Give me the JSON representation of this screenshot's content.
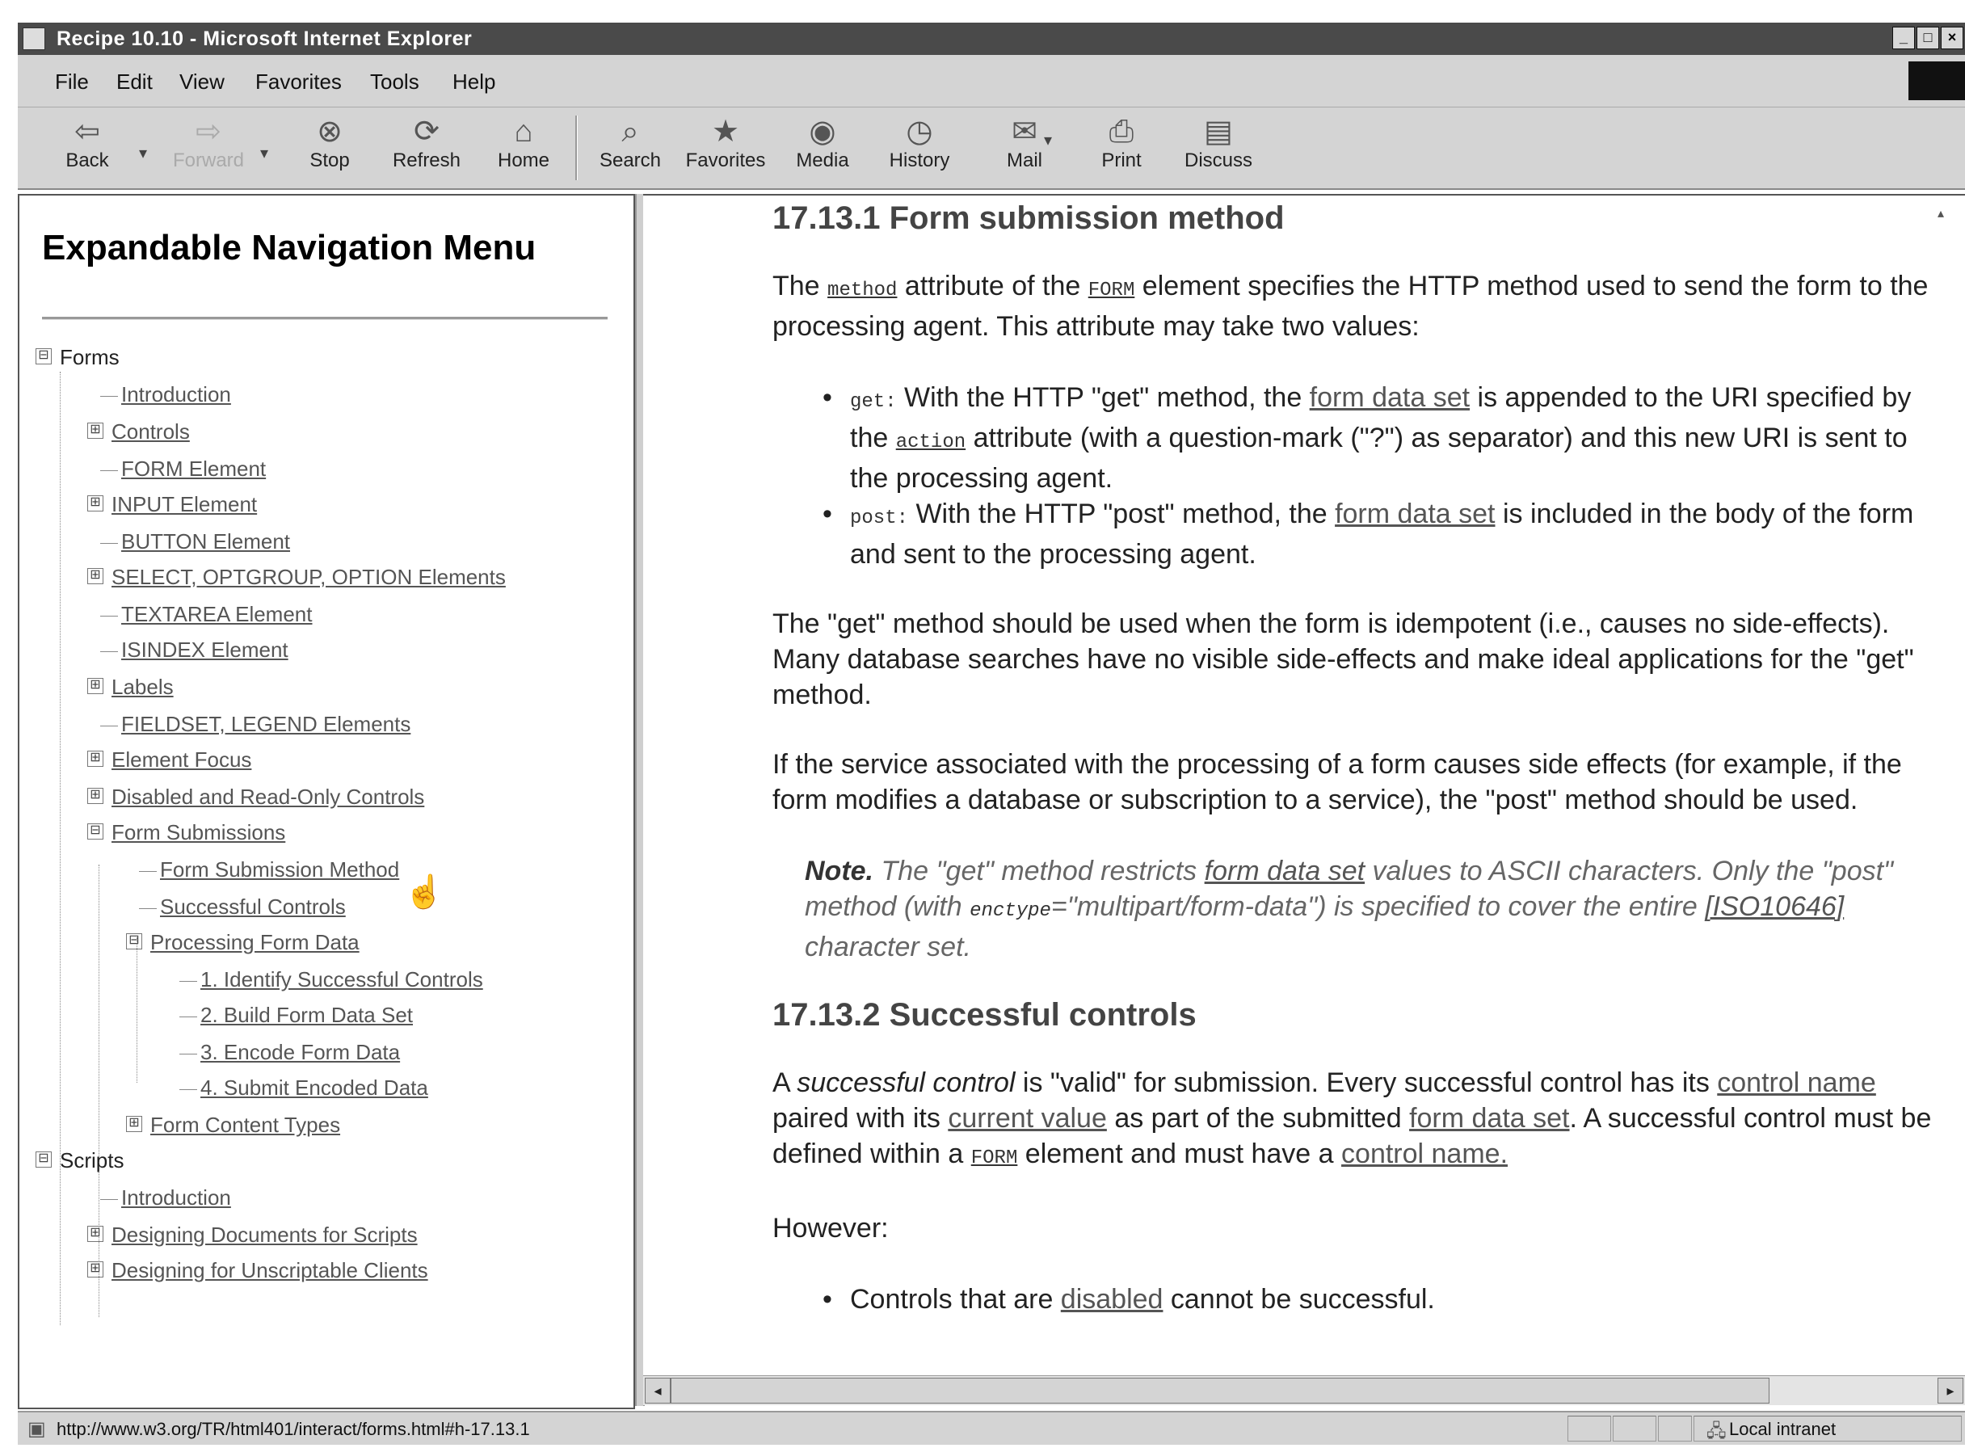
{
  "window": {
    "title": "Recipe 10.10 - Microsoft Internet Explorer",
    "controls": [
      "_",
      "□",
      "×"
    ]
  },
  "menu": [
    "File",
    "Edit",
    "View",
    "Favorites",
    "Tools",
    "Help"
  ],
  "toolbar": [
    {
      "label": "Back",
      "icon": "back-arrow-icon",
      "glyph": "⇦"
    },
    {
      "label": "Forward",
      "icon": "forward-arrow-icon",
      "glyph": "⇨"
    },
    {
      "label": "Stop",
      "icon": "stop-icon",
      "glyph": "⊗"
    },
    {
      "label": "Refresh",
      "icon": "refresh-icon",
      "glyph": "⟳"
    },
    {
      "label": "Home",
      "icon": "home-icon",
      "glyph": "⌂"
    },
    {
      "label": "Search",
      "icon": "search-icon",
      "glyph": "⌕"
    },
    {
      "label": "Favorites",
      "icon": "favorites-icon",
      "glyph": "★"
    },
    {
      "label": "Media",
      "icon": "media-icon",
      "glyph": "◉"
    },
    {
      "label": "History",
      "icon": "history-icon",
      "glyph": "◷"
    },
    {
      "label": "Mail",
      "icon": "mail-icon",
      "glyph": "✉"
    },
    {
      "label": "Print",
      "icon": "print-icon",
      "glyph": "⎙"
    },
    {
      "label": "Discuss",
      "icon": "discuss-icon",
      "glyph": "▤"
    }
  ],
  "nav": {
    "title": "Expandable Navigation Menu",
    "items": [
      {
        "label": "Forms",
        "expander": "⊟"
      },
      {
        "label": "Introduction"
      },
      {
        "label": "Controls",
        "expander": "⊞"
      },
      {
        "label": "FORM Element"
      },
      {
        "label": "INPUT Element",
        "expander": "⊞"
      },
      {
        "label": "BUTTON Element"
      },
      {
        "label": "SELECT, OPTGROUP, OPTION Elements",
        "expander": "⊞"
      },
      {
        "label": "TEXTAREA Element"
      },
      {
        "label": "ISINDEX Element"
      },
      {
        "label": "Labels",
        "expander": "⊞"
      },
      {
        "label": "FIELDSET, LEGEND Elements"
      },
      {
        "label": "Element Focus",
        "expander": "⊞"
      },
      {
        "label": "Disabled and Read-Only Controls",
        "expander": "⊞"
      },
      {
        "label": "Form Submissions",
        "expander": "⊟"
      },
      {
        "label": "Form Submission Method"
      },
      {
        "label": "Successful Controls"
      },
      {
        "label": "Processing Form Data",
        "expander": "⊟"
      },
      {
        "label": "1. Identify Successful Controls"
      },
      {
        "label": "2. Build Form Data Set"
      },
      {
        "label": "3. Encode Form Data"
      },
      {
        "label": "4. Submit Encoded Data"
      },
      {
        "label": "Form Content Types",
        "expander": "⊞"
      },
      {
        "label": "Scripts",
        "expander": "⊟"
      },
      {
        "label": "Introduction"
      },
      {
        "label": "Designing Documents for Scripts",
        "expander": "⊞"
      },
      {
        "label": "Designing for Unscriptable Clients",
        "expander": "⊞"
      }
    ]
  },
  "content": {
    "h1": "17.13.1 Form submission method",
    "p1": {
      "a": "The ",
      "method": "method",
      "b": " attribute of the ",
      "form": "FORM",
      "c": " element specifies the HTTP method used to send the form to the processing agent. This attribute may take two values:"
    },
    "get": {
      "code": "get:",
      "a": " With the HTTP \"get\" method, the ",
      "link": "form data set",
      "b": " is appended to the URI specified by the ",
      "action": "action",
      "c": " attribute (with a question-mark (\"?\") as separator) and this new URI is sent to the processing agent."
    },
    "post": {
      "code": "post:",
      "a": " With the HTTP \"post\" method, the ",
      "link": "form data set",
      "b": " is included in the body of the form and sent to the processing agent."
    },
    "p2": "The \"get\" method should be used when the form is idempotent (i.e., causes no side-effects). Many database searches have no visible side-effects and make ideal applications for the \"get\" method.",
    "p3": "If the service associated with the processing of a form causes side effects (for example, if the form modifies a database or subscription to a service), the \"post\" method should be used.",
    "note": {
      "label": "Note.",
      "a": " The \"get\" method restricts ",
      "link": "form data set",
      "b": " values to ASCII characters. Only the \"post\" method (with ",
      "code": "enctype",
      "c": "=\"multipart/form-data\") is specified to cover the entire ",
      "iso": "[ISO10646]",
      "d": " character set."
    },
    "h2": "17.13.2 Successful controls",
    "p4": {
      "a": "A ",
      "em": "successful control",
      "b": " is \"valid\" for submission. Every successful control has its ",
      "l1": "control name",
      "c": " paired with its ",
      "l2": "current value",
      "d": " as part of the submitted ",
      "l3": "form data set",
      "e": ". A successful control must be defined within a ",
      "form": "FORM",
      "f": " element and must have a ",
      "l4": "control name.",
      "g": ""
    },
    "p5": "However:",
    "li1": {
      "a": "Controls that are ",
      "link": "disabled",
      "b": " cannot be successful."
    }
  },
  "status": {
    "url": "http://www.w3.org/TR/html401/interact/forms.html#h-17.13.1",
    "zone": "Local intranet"
  }
}
